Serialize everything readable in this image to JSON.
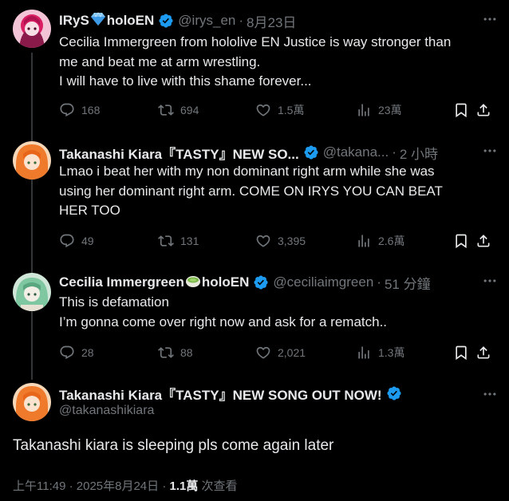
{
  "colors": {
    "background": "#000000",
    "text": "#e7e9ea",
    "muted": "#71767b",
    "verified": "#1d9bf0",
    "line": "#333639"
  },
  "tweets": [
    {
      "name": "IRyS",
      "emoji": "gem-icon",
      "name_suffix": "holoEN",
      "handle": "@irys_en",
      "time": "8月23日",
      "text": [
        "Cecilia Immergreen from hololive EN Justice is way stronger than",
        "me and beat me at arm wrestling.",
        "I will have to live with this shame forever..."
      ],
      "replies": "168",
      "retweets": "694",
      "likes": "1.5萬",
      "views": "23萬"
    },
    {
      "name": "Takanashi Kiara『TASTY』NEW SO...",
      "handle": "@takana...",
      "time": "2 小時",
      "text": [
        "Lmao i beat her with my non dominant right arm while she was",
        "using her dominant right arm. COME ON IRYS YOU CAN BEAT",
        "HER TOO"
      ],
      "replies": "49",
      "retweets": "131",
      "likes": "3,395",
      "views": "2.6萬"
    },
    {
      "name": "Cecilia Immergreen",
      "emoji": "tea-icon",
      "name_suffix": "holoEN",
      "handle": "@ceciliaimgreen",
      "time": "51 分鐘",
      "text": [
        "This is defamation",
        "I’m gonna come over right now and ask for a rematch.."
      ],
      "replies": "28",
      "retweets": "88",
      "likes": "2,021",
      "views": "1.3萬"
    }
  ],
  "main": {
    "name": "Takanashi Kiara『TASTY』NEW SONG OUT NOW!",
    "handle": "@takanashikiara",
    "text": "Takanashi kiara is sleeping pls come again later",
    "timestamp": "上午11:49 · 2025年8月24日 · ",
    "views_count": "1.1萬",
    "views_label": " 次查看"
  }
}
